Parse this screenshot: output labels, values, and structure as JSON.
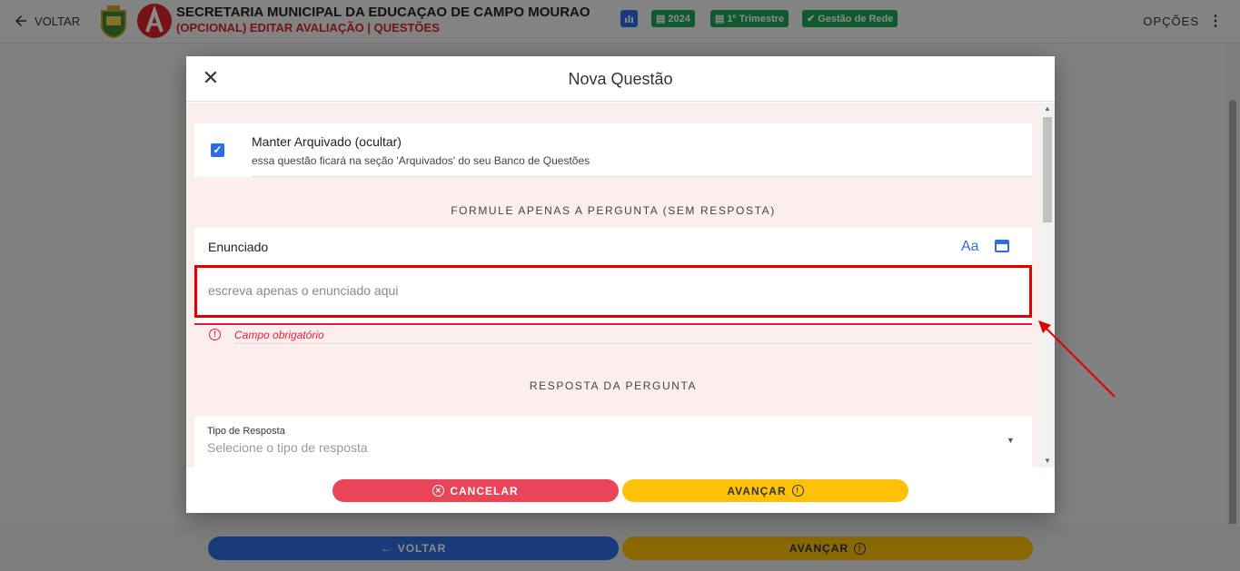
{
  "topbar": {
    "back_label": "VOLTAR",
    "org_title": "SECRETARIA MUNICIPAL DA EDUCAÇAO DE CAMPO MOURAO",
    "subtitle": "(OPCIONAL) EDITAR AVALIAÇÃO | QUESTÕES",
    "chips": [
      "2024",
      "1º Trimestre",
      "Gestão de Rede"
    ],
    "options_label": "OPÇÕES"
  },
  "page_footer": {
    "back_label": "VOLTAR",
    "next_label": "AVANÇAR"
  },
  "modal": {
    "title": "Nova Questão",
    "archive": {
      "checked": true,
      "title": "Manter Arquivado (ocultar)",
      "description": "essa questão ficará na seção 'Arquivados' do seu Banco de Questões"
    },
    "question_section_heading": "FORMULE APENAS A PERGUNTA (SEM RESPOSTA)",
    "statement": {
      "label": "Enunciado",
      "font_button": "Aa",
      "placeholder": "escreva apenas o enunciado aqui",
      "error": "Campo obrigatório"
    },
    "answer_section_heading": "RESPOSTA DA PERGUNTA",
    "answer_type": {
      "label": "Tipo de Resposta",
      "placeholder": "Selecione o tipo de resposta"
    },
    "cancel_label": "CANCELAR",
    "next_label": "AVANÇAR"
  },
  "colors": {
    "primary": "#2d6de0",
    "danger": "#ea4459",
    "warning": "#ffc107",
    "success": "#1aa654",
    "error_text": "#e0203a"
  }
}
